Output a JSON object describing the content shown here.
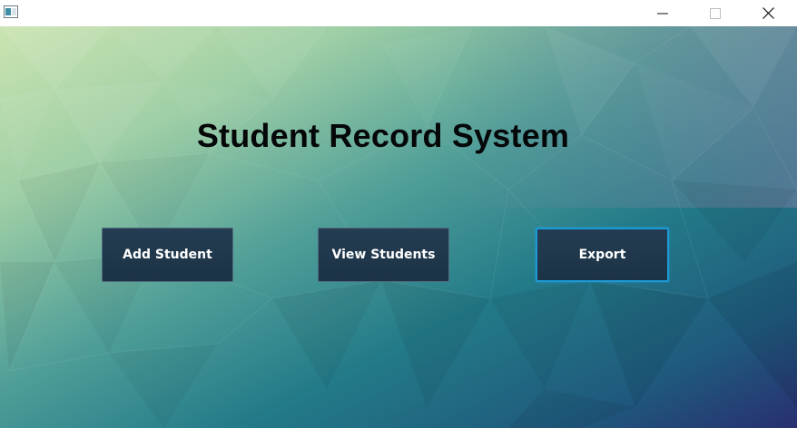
{
  "window": {
    "controls": {
      "minimize_icon": "minimize-icon",
      "maximize_icon": "maximize-icon",
      "close_icon": "close-icon"
    }
  },
  "main": {
    "title": "Student Record System",
    "buttons": [
      {
        "label": "Add Student"
      },
      {
        "label": "View Students"
      },
      {
        "label": "Export",
        "focused": true
      }
    ]
  },
  "colors": {
    "button_bg": "#1f374b",
    "button_text": "#ffffff",
    "focus_border": "#1b9ad6",
    "title_text": "#050708",
    "bg_top_left": "#c4e0ad",
    "bg_bottom_right": "#263a72"
  }
}
